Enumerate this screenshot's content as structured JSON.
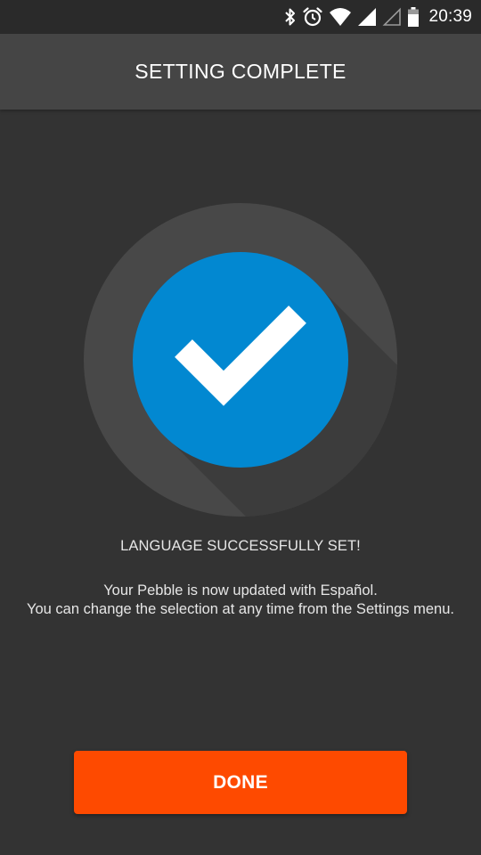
{
  "status_bar": {
    "time": "20:39",
    "icons": [
      "bluetooth-icon",
      "alarm-icon",
      "wifi-icon",
      "signal-icon",
      "signal-empty-icon",
      "battery-icon"
    ]
  },
  "header": {
    "title": "SETTING COMPLETE"
  },
  "main": {
    "icon": "checkmark-icon",
    "message_title": "LANGUAGE SUCCESSFULLY SET!",
    "message_lines": [
      "Your Pebble is now updated with Español.",
      "You can change the selection at any time from the Settings menu."
    ]
  },
  "footer": {
    "done_label": "DONE"
  },
  "colors": {
    "background": "#333333",
    "app_bar": "#454545",
    "ring": "#484848",
    "accent_blue": "#0288d1",
    "button_orange": "#fe4a00"
  }
}
